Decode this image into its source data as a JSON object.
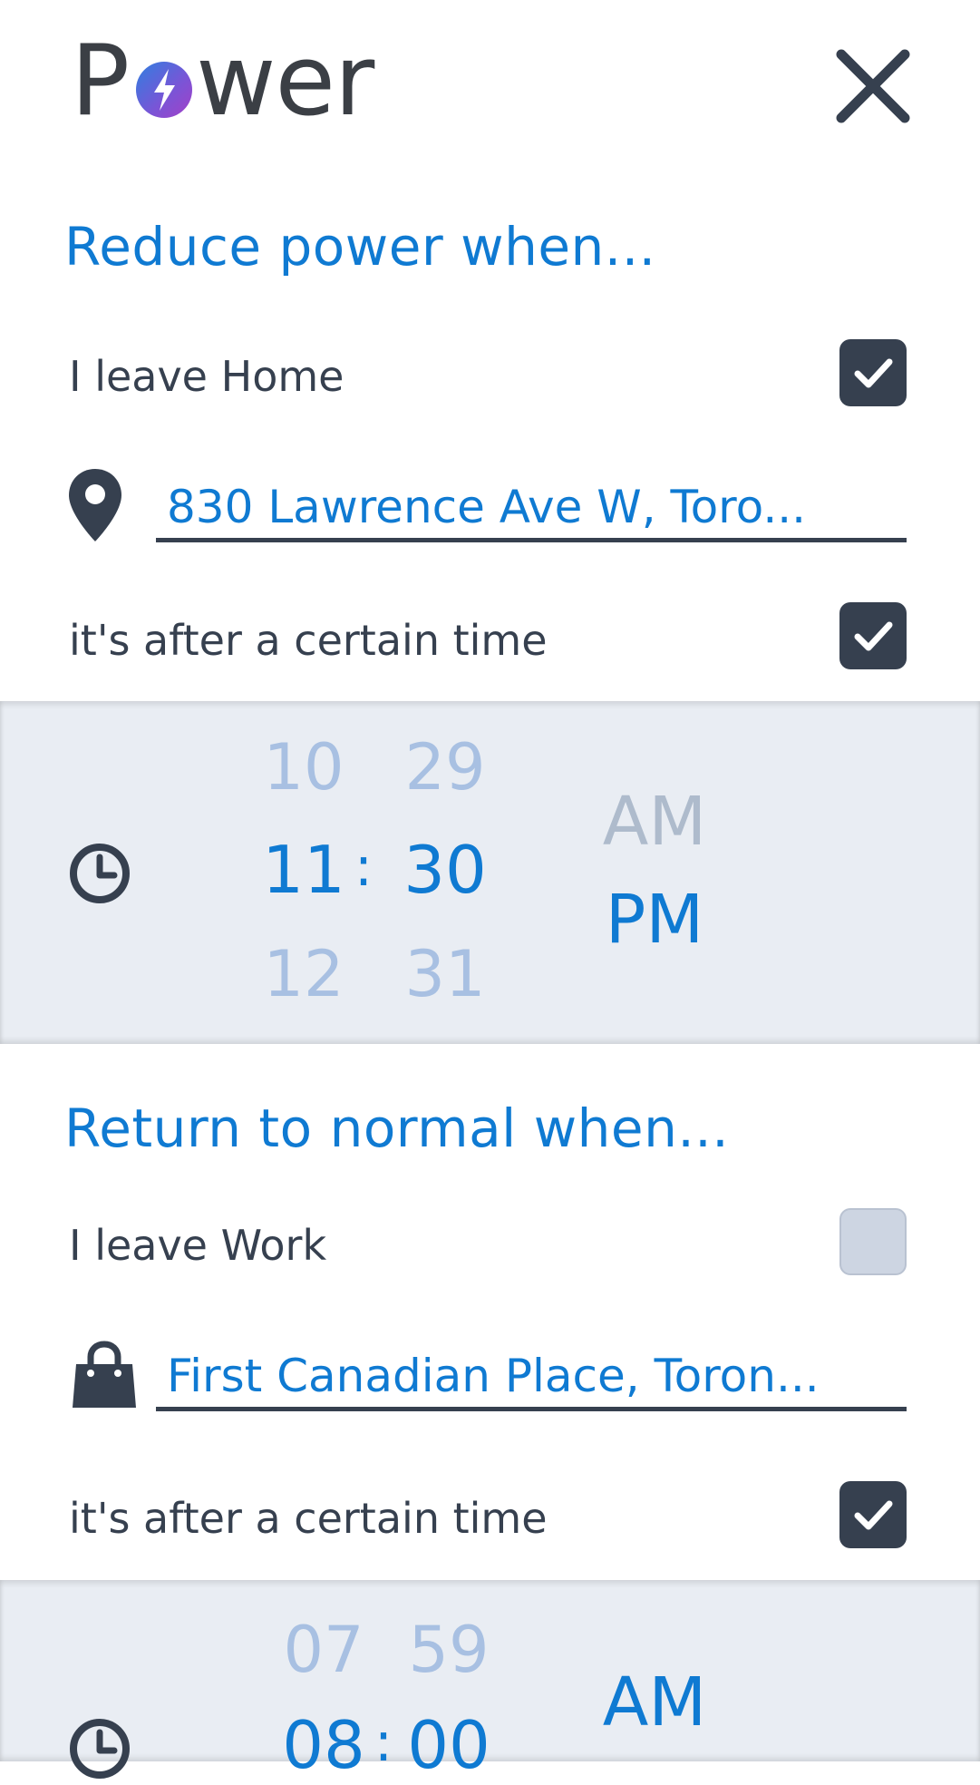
{
  "app": {
    "title_prefix": "P",
    "title_suffix": "wer",
    "close_label": "Close"
  },
  "reduce": {
    "title": "Reduce power when...",
    "leave": {
      "label": "I leave Home",
      "checked": true
    },
    "location": {
      "value": "830 Lawrence Ave W, Toro..."
    },
    "after_time": {
      "label": "it's after a certain time",
      "checked": true
    },
    "picker": {
      "hour_prev": "10",
      "hour": "11",
      "hour_next": "12",
      "separator": ":",
      "minute_prev": "29",
      "minute": "30",
      "minute_next": "31",
      "am": "AM",
      "pm": "PM",
      "selected_period": "PM"
    }
  },
  "normal": {
    "title": "Return to normal when...",
    "leave": {
      "label": "I leave Work",
      "checked": false
    },
    "location": {
      "value": "First Canadian Place, Toron..."
    },
    "after_time": {
      "label": "it's after a certain time",
      "checked": true
    },
    "picker": {
      "hour_prev": "07",
      "hour": "08",
      "separator": ":",
      "minute_prev": "59",
      "minute": "00",
      "am": "AM",
      "selected_period": "AM"
    }
  },
  "colors": {
    "accent": "#0f7ad2",
    "dark": "#36404f",
    "picker_bg": "#e9edf3",
    "dim_number": "#a8c0e2"
  }
}
